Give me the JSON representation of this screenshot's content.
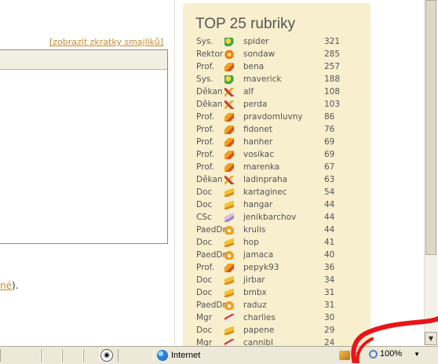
{
  "content": {
    "smileys_link": "[zobrazit zkratky smajlíků]",
    "note_tail_link": "né",
    "note_tail_after": ")."
  },
  "top_panel": {
    "title": "TOP 25 rubriky",
    "rows": [
      {
        "rank": "Sys.",
        "icon": "sys-badge-icon",
        "name": "spider",
        "points": "321"
      },
      {
        "rank": "Rektor",
        "icon": "rektor-badge-icon",
        "name": "sondaw",
        "points": "285"
      },
      {
        "rank": "Prof.",
        "icon": "prof-badge-icon",
        "name": "bena",
        "points": "257"
      },
      {
        "rank": "Sys.",
        "icon": "sys-badge-icon",
        "name": "maverick",
        "points": "188"
      },
      {
        "rank": "Děkan",
        "icon": "dekan-badge-icon",
        "name": "alf",
        "points": "108"
      },
      {
        "rank": "Děkan",
        "icon": "dekan-badge-icon",
        "name": "perda",
        "points": "103"
      },
      {
        "rank": "Prof.",
        "icon": "prof-badge-icon",
        "name": "pravdomluvny",
        "points": "86"
      },
      {
        "rank": "Prof.",
        "icon": "prof-badge-icon",
        "name": "fidonet",
        "points": "76"
      },
      {
        "rank": "Prof.",
        "icon": "prof-badge-icon",
        "name": "hanher",
        "points": "69"
      },
      {
        "rank": "Prof.",
        "icon": "prof-badge-icon",
        "name": "vosikac",
        "points": "69"
      },
      {
        "rank": "Prof.",
        "icon": "prof-badge-icon",
        "name": "marenka",
        "points": "67"
      },
      {
        "rank": "Děkan",
        "icon": "dekan-badge-icon",
        "name": "ladinpraha",
        "points": "63"
      },
      {
        "rank": "Doc",
        "icon": "doc-badge-icon",
        "name": "kartaginec",
        "points": "54"
      },
      {
        "rank": "Doc",
        "icon": "doc-badge-icon",
        "name": "hangar",
        "points": "44"
      },
      {
        "rank": "CSc",
        "icon": "csc-badge-icon",
        "name": "jenikbarchov",
        "points": "44"
      },
      {
        "rank": "PaedDr",
        "icon": "paeddr-badge-icon",
        "name": "krulis",
        "points": "44"
      },
      {
        "rank": "Doc",
        "icon": "doc-badge-icon",
        "name": "hop",
        "points": "41"
      },
      {
        "rank": "PaedDr",
        "icon": "paeddr-badge-icon",
        "name": "jamaca",
        "points": "40"
      },
      {
        "rank": "Prof.",
        "icon": "prof-badge-icon",
        "name": "pepyk93",
        "points": "36"
      },
      {
        "rank": "Doc",
        "icon": "doc-badge-icon",
        "name": "jirbar",
        "points": "34"
      },
      {
        "rank": "Doc",
        "icon": "doc-badge-icon",
        "name": "bmbx",
        "points": "31"
      },
      {
        "rank": "PaedDr",
        "icon": "paeddr-badge-icon",
        "name": "raduz",
        "points": "31"
      },
      {
        "rank": "Mgr",
        "icon": "mgr-badge-icon",
        "name": "charlies",
        "points": "30"
      },
      {
        "rank": "Doc",
        "icon": "doc-badge-icon",
        "name": "papene",
        "points": "29"
      },
      {
        "rank": "Mgr",
        "icon": "mgr-badge-icon",
        "name": "cannibl",
        "points": "24"
      }
    ]
  },
  "statusbar": {
    "zone": "Internet",
    "zoom": "100%",
    "privacy_icon": "privacy-eye-icon"
  },
  "colors": {
    "panel_bg": "#f7efcd",
    "link": "#c98a2a",
    "annotation_red": "#e8141a"
  }
}
